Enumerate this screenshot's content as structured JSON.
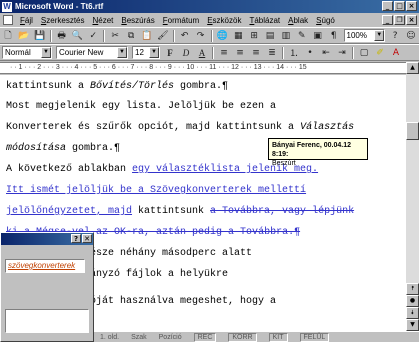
{
  "window": {
    "title": "Microsoft Word - Tt6.rtf"
  },
  "menu": {
    "items": [
      "Fájl",
      "Szerkesztés",
      "Nézet",
      "Beszúrás",
      "Formátum",
      "Eszközök",
      "Táblázat",
      "Ablak",
      "Súgó"
    ]
  },
  "toolbar": {
    "zoom": "100%",
    "style": "Normál",
    "font": "Courier New",
    "size": "12",
    "bold": "F",
    "italic": "D",
    "underline": "A"
  },
  "ruler": {
    "text": "· · 1 · · · 2 · · · 3 · · · 4 · · · 5 · · · 6 · · · 7 · · · 8 · · · 9 · · · 10 · · · 11 · · · 12 · · · 13 · · · 14 · · · 15"
  },
  "document": {
    "line1": {
      "a": "kattintsunk a ",
      "b": "Bővítés/Törlés",
      "c": " gombra.¶"
    },
    "line2": "    Most megjelenik egy lista. Jelöljük be ezen a",
    "line3": {
      "a": "Konverterek és szűrők opciót, majd kattintsunk a ",
      "b": "Választás"
    },
    "line4": {
      "a": "módosítása",
      "b": " gombra.¶"
    },
    "line5": {
      "a": "    A következő ablakban ",
      "b": "egy választéklista jelenik meg."
    },
    "line6": "Itt ismét jelöljük be a Szövegkonverterek mellettí",
    "line7": {
      "a": "jelölőnégyzetet, majd",
      "b": " kattintsunk ",
      "c": "a Továbbra, vagy lépjünk"
    },
    "line8": {
      "a": "ki a ",
      "b": "Mégse",
      "c": "-vel az OK-ra, aztán pedig a Továbbra.¶"
    },
    "line9": "          és hátralevő része néhány másodperc alatt",
    "line10": "          lefut, és a hiányzó fájlok a helyükre",
    "line11": "          ? magyar verzióját használva megeshet, hogy a"
  },
  "comment": {
    "author": "Bányai Ferenc, 00.04.12 8:19:",
    "type": "Beszúrt"
  },
  "dialog": {
    "field_value": "szövegkonverterek",
    "help": "?",
    "close": "✕"
  },
  "status": {
    "items": [
      "1. old.",
      "Szak",
      "Pozíció",
      "REC",
      "KORR",
      "KIT",
      "FELÜL"
    ]
  }
}
